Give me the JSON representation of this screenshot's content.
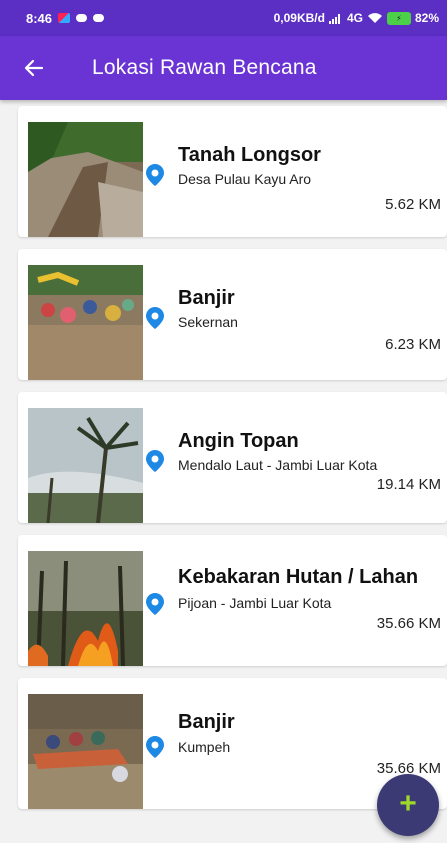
{
  "status_bar": {
    "time": "8:46",
    "network_info": "0,09KB/d",
    "signal_label": "4G",
    "battery": "82%"
  },
  "app_bar": {
    "back_icon": "arrow-left-icon",
    "title": "Lokasi Rawan Bencana"
  },
  "locations": [
    {
      "name": "Tanah Longsor",
      "place": "Desa Pulau Kayu Aro",
      "distance": "5.62 KM"
    },
    {
      "name": "Banjir",
      "place": "Sekernan",
      "distance": "6.23 KM"
    },
    {
      "name": "Angin Topan",
      "place": "Mendalo Laut - Jambi Luar Kota",
      "distance": "19.14 KM"
    },
    {
      "name": "Kebakaran Hutan / Lahan",
      "place": "Pijoan - Jambi Luar Kota",
      "distance": "35.66 KM"
    },
    {
      "name": "Banjir",
      "place": "Kumpeh",
      "distance": "35.66 KM"
    }
  ],
  "fab": {
    "icon": "plus-icon",
    "label": "+"
  },
  "colors": {
    "status_bar": "#5b2fc4",
    "app_bar": "#6a34d4",
    "pin": "#1e88e5",
    "fab": "#3b3a74",
    "fab_plus": "#9ed82a"
  }
}
